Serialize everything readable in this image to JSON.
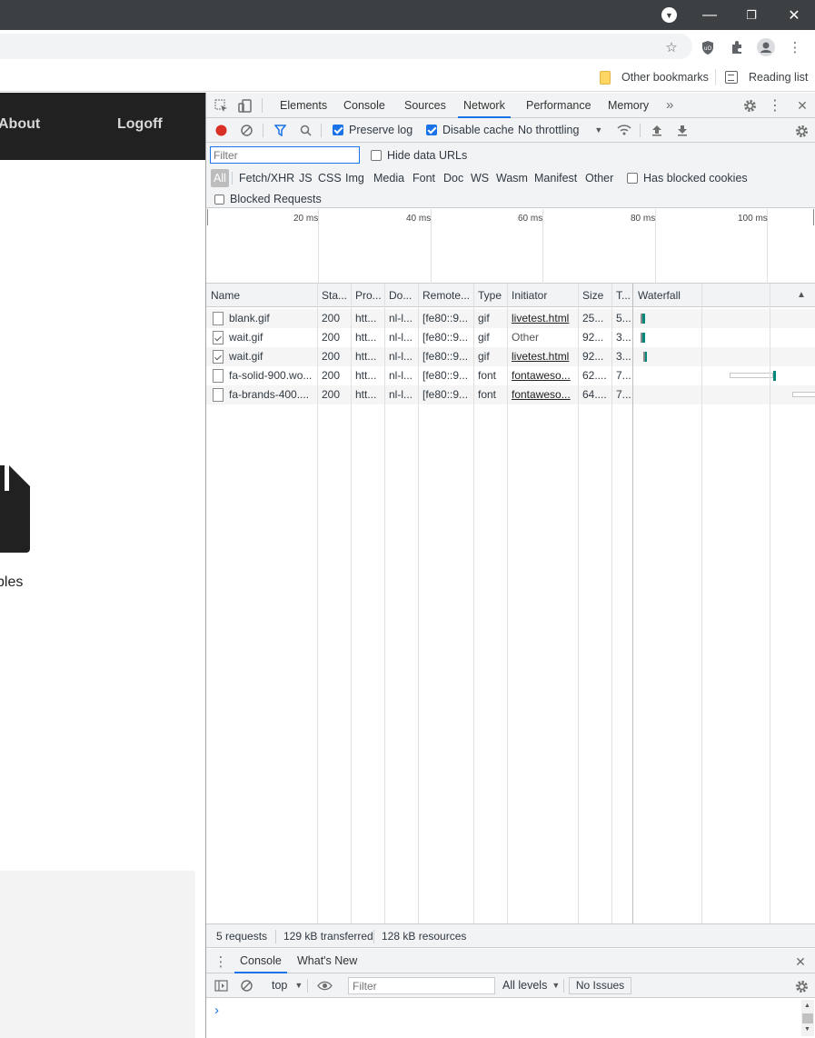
{
  "browser": {
    "window_buttons": {
      "minimize": "—",
      "restore": "❐",
      "close": "✕"
    },
    "bookmarks": {
      "other_bookmarks": "Other bookmarks",
      "reading_list": "Reading list"
    }
  },
  "page": {
    "nav": {
      "about": "About",
      "logoff": "Logoff"
    },
    "label": "ples"
  },
  "devtools": {
    "tabs": [
      "Elements",
      "Console",
      "Sources",
      "Network",
      "Performance",
      "Memory"
    ],
    "more_tabs": "»",
    "toolbar": {
      "preserve_log": "Preserve log",
      "preserve_log_checked": true,
      "disable_cache": "Disable cache",
      "disable_cache_checked": true,
      "throttling": "No throttling"
    },
    "filter": {
      "placeholder": "Filter",
      "hide_data_urls": "Hide data URLs",
      "types": [
        "All",
        "Fetch/XHR",
        "JS",
        "CSS",
        "Img",
        "Media",
        "Font",
        "Doc",
        "WS",
        "Wasm",
        "Manifest",
        "Other"
      ],
      "has_blocked_cookies": "Has blocked cookies",
      "blocked_requests": "Blocked Requests"
    },
    "overview_ticks": [
      "20 ms",
      "40 ms",
      "60 ms",
      "80 ms",
      "100 ms"
    ],
    "table": {
      "columns": [
        "Name",
        "Sta...",
        "Pro...",
        "Do...",
        "Remote...",
        "Type",
        "Initiator",
        "Size",
        "T...",
        "Waterfall"
      ],
      "sort_indicator": "▲",
      "rows": [
        {
          "name": "blank.gif",
          "status": "200",
          "protocol": "htt...",
          "domain": "nl-l...",
          "remote": "[fe80::9...",
          "type": "gif",
          "initiator": "livetest.html",
          "initiator_link": true,
          "size": "25...",
          "time": "5..."
        },
        {
          "name": "wait.gif",
          "status": "200",
          "protocol": "htt...",
          "domain": "nl-l...",
          "remote": "[fe80::9...",
          "type": "gif",
          "initiator": "Other",
          "initiator_link": false,
          "size": "92...",
          "time": "3..."
        },
        {
          "name": "wait.gif",
          "status": "200",
          "protocol": "htt...",
          "domain": "nl-l...",
          "remote": "[fe80::9...",
          "type": "gif",
          "initiator": "livetest.html",
          "initiator_link": true,
          "size": "92...",
          "time": "3..."
        },
        {
          "name": "fa-solid-900.wo...",
          "status": "200",
          "protocol": "htt...",
          "domain": "nl-l...",
          "remote": "[fe80::9...",
          "type": "font",
          "initiator": "fontaweso...",
          "initiator_link": true,
          "size": "62....",
          "time": "7..."
        },
        {
          "name": "fa-brands-400....",
          "status": "200",
          "protocol": "htt...",
          "domain": "nl-l...",
          "remote": "[fe80::9...",
          "type": "font",
          "initiator": "fontaweso...",
          "initiator_link": true,
          "size": "64....",
          "time": "7..."
        }
      ]
    },
    "status": {
      "requests": "5 requests",
      "transferred": "129 kB transferred",
      "resources": "128 kB resources"
    },
    "drawer": {
      "tabs": [
        "Console",
        "What's New"
      ],
      "context": "top",
      "filter_placeholder": "Filter",
      "levels": "All levels",
      "issues": "No Issues",
      "prompt": "›"
    },
    "colors": {
      "accent": "#1a73e8",
      "record": "#d93025",
      "waterfall_bar": "#00897b"
    }
  }
}
